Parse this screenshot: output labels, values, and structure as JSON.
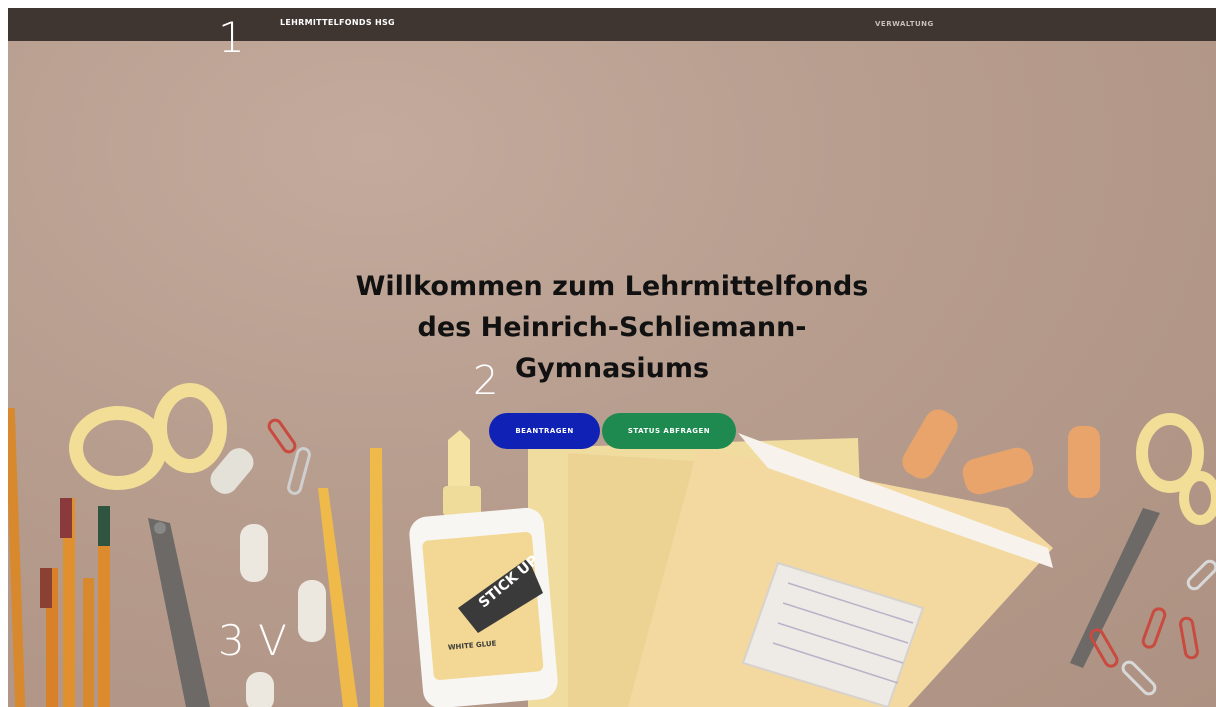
{
  "navbar": {
    "brand": "LEHRMITTELFONDS HSG",
    "admin_link": "VERWALTUNG"
  },
  "hero": {
    "title_lines": [
      "Willkommen zum Lehrmittelfonds",
      "des Heinrich-Schliemann-",
      "Gymnasiums"
    ],
    "buttons": {
      "apply": "BEANTRAGEN",
      "status": "STATUS ABFRAGEN"
    },
    "glue_label": "STICK UP",
    "glue_sub": "WHITE GLUE"
  },
  "annotations": {
    "a1": "1",
    "a2": "2",
    "a3": "3 V"
  },
  "colors": {
    "navbar": "#3f3632",
    "primary_button": "#1021b5",
    "success_button": "#1e8a4f",
    "background": "#b89e8f"
  },
  "icons": [
    "scissors-icon",
    "pencil-icon",
    "glue-bottle-icon",
    "notebook-icon",
    "eraser-icon",
    "paperclip-icon",
    "chevron-down-icon"
  ]
}
